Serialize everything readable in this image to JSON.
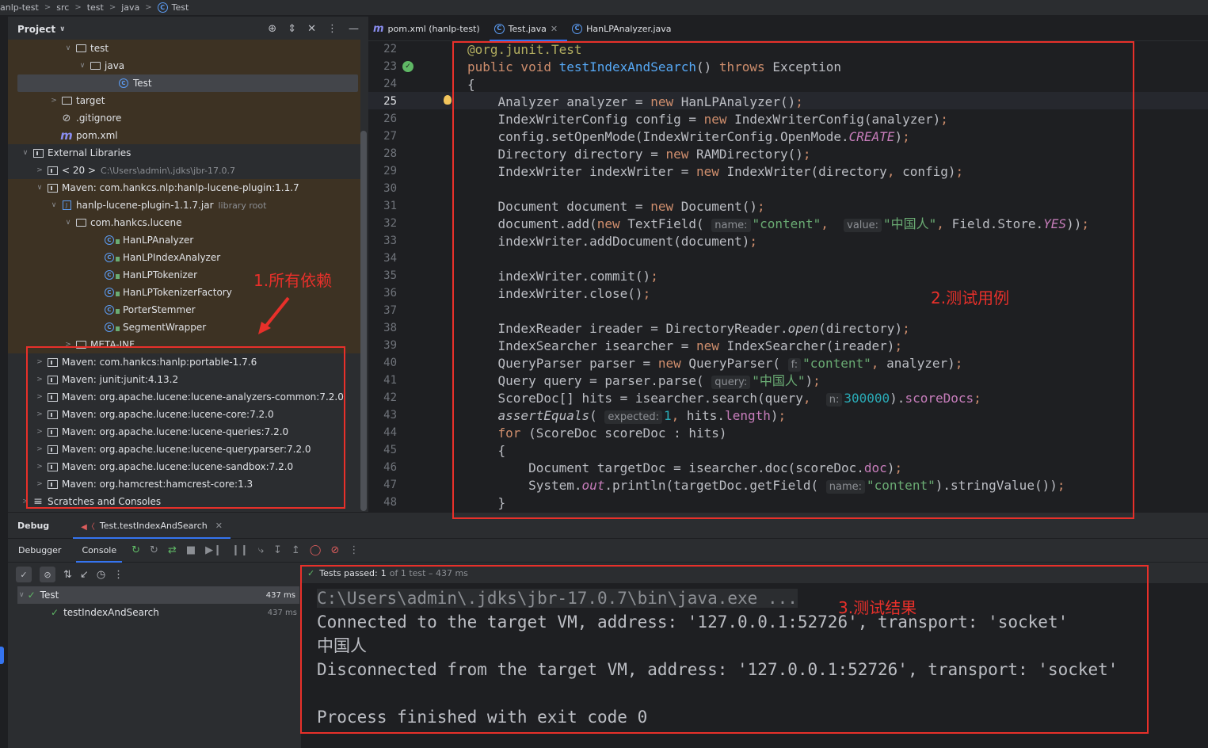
{
  "breadcrumb": [
    "anlp-test",
    "src",
    "test",
    "java",
    "Test"
  ],
  "project": {
    "title": "Project",
    "tree": [
      {
        "label": "test",
        "indent": 4,
        "chev": "v",
        "icon": "folder"
      },
      {
        "label": "java",
        "indent": 5,
        "chev": "v",
        "icon": "folder"
      },
      {
        "label": "Test",
        "indent": 7,
        "chev": "",
        "icon": "class",
        "selected": true
      },
      {
        "label": "target",
        "indent": 3,
        "chev": ">",
        "icon": "folder"
      },
      {
        "label": ".gitignore",
        "indent": 3,
        "chev": "",
        "icon": "ignore"
      },
      {
        "label": "pom.xml",
        "indent": 3,
        "chev": "",
        "icon": "maven"
      },
      {
        "label": "External Libraries",
        "indent": 1,
        "chev": "v",
        "icon": "lib"
      },
      {
        "label": "< 20 >",
        "extra": "C:\\Users\\admin\\.jdks\\jbr-17.0.7",
        "indent": 2,
        "chev": ">",
        "icon": "lib"
      },
      {
        "label": "Maven: com.hankcs.nlp:hanlp-lucene-plugin:1.1.7",
        "indent": 2,
        "chev": "v",
        "icon": "lib"
      },
      {
        "label": "hanlp-lucene-plugin-1.1.7.jar",
        "extra": "library root",
        "indent": 3,
        "chev": "v",
        "icon": "jar"
      },
      {
        "label": "com.hankcs.lucene",
        "indent": 4,
        "chev": "v",
        "icon": "folder"
      },
      {
        "label": "HanLPAnalyzer",
        "indent": 6,
        "chev": "",
        "icon": "class"
      },
      {
        "label": "HanLPIndexAnalyzer",
        "indent": 6,
        "chev": "",
        "icon": "class"
      },
      {
        "label": "HanLPTokenizer",
        "indent": 6,
        "chev": "",
        "icon": "class"
      },
      {
        "label": "HanLPTokenizerFactory",
        "indent": 6,
        "chev": "",
        "icon": "class"
      },
      {
        "label": "PorterStemmer",
        "indent": 6,
        "chev": "",
        "icon": "class"
      },
      {
        "label": "SegmentWrapper",
        "indent": 6,
        "chev": "",
        "icon": "class"
      },
      {
        "label": "META-INF",
        "indent": 4,
        "chev": ">",
        "icon": "folder"
      },
      {
        "label": "Maven: com.hankcs:hanlp:portable-1.7.6",
        "indent": 2,
        "chev": ">",
        "icon": "lib"
      },
      {
        "label": "Maven: junit:junit:4.13.2",
        "indent": 2,
        "chev": ">",
        "icon": "lib"
      },
      {
        "label": "Maven: org.apache.lucene:lucene-analyzers-common:7.2.0",
        "indent": 2,
        "chev": ">",
        "icon": "lib"
      },
      {
        "label": "Maven: org.apache.lucene:lucene-core:7.2.0",
        "indent": 2,
        "chev": ">",
        "icon": "lib"
      },
      {
        "label": "Maven: org.apache.lucene:lucene-queries:7.2.0",
        "indent": 2,
        "chev": ">",
        "icon": "lib"
      },
      {
        "label": "Maven: org.apache.lucene:lucene-queryparser:7.2.0",
        "indent": 2,
        "chev": ">",
        "icon": "lib"
      },
      {
        "label": "Maven: org.apache.lucene:lucene-sandbox:7.2.0",
        "indent": 2,
        "chev": ">",
        "icon": "lib"
      },
      {
        "label": "Maven: org.hamcrest:hamcrest-core:1.3",
        "indent": 2,
        "chev": ">",
        "icon": "lib"
      },
      {
        "label": "Scratches and Consoles",
        "indent": 1,
        "chev": ">",
        "icon": "scratch"
      }
    ]
  },
  "editor": {
    "tabs": [
      {
        "label": "pom.xml (hanlp-test)",
        "icon": "m"
      },
      {
        "label": "Test.java",
        "icon": "c",
        "active": true
      },
      {
        "label": "HanLPAnalyzer.java",
        "icon": "c"
      }
    ],
    "first_line": 22,
    "current_line": 25,
    "lines": [
      "<span class='an'>@org.junit.Test</span>",
      "<span class='kw'>public void </span><span class='fn'>testIndexAndSearch</span>() <span class='kw'>throws </span>Exception",
      "{",
      "    Analyzer analyzer = <span class='kw'>new </span>HanLPAnalyzer()<span class='kw'>;</span>",
      "    IndexWriterConfig config = <span class='kw'>new </span>IndexWriterConfig(analyzer)<span class='kw'>;</span>",
      "    config.setOpenMode(IndexWriterConfig.OpenMode.<span class='pu'>CREATE</span>)<span class='kw'>;</span>",
      "    Directory directory = <span class='kw'>new </span>RAMDirectory()<span class='kw'>;</span>",
      "    IndexWriter indexWriter = <span class='kw'>new </span>IndexWriter(directory<span class='kw'>, </span>config)<span class='kw'>;</span>",
      "",
      "    Document document = <span class='kw'>new </span>Document()<span class='kw'>;</span>",
      "    document.add(<span class='kw'>new </span>TextField( <span class='hint'>name:</span><span class='st'>\"content\"</span><span class='kw'>, </span> <span class='hint'>value:</span><span class='st'>\"中国人\"</span><span class='kw'>, </span>Field.Store.<span class='pu'>YES</span>))<span class='kw'>;</span>",
      "    indexWriter.addDocument(document)<span class='kw'>;</span>",
      "",
      "    indexWriter.commit()<span class='kw'>;</span>",
      "    indexWriter.close()<span class='kw'>;</span>",
      "",
      "    IndexReader ireader = DirectoryReader.<span class='it'>open</span>(directory)<span class='kw'>;</span>",
      "    IndexSearcher isearcher = <span class='kw'>new </span>IndexSearcher(ireader)<span class='kw'>;</span>",
      "    QueryParser parser = <span class='kw'>new </span>QueryParser( <span class='hint'>f:</span><span class='st'>\"content\"</span><span class='kw'>, </span>analyzer)<span class='kw'>;</span>",
      "    Query query = parser.parse( <span class='hint'>query:</span><span class='st'>\"中国人\"</span>)<span class='kw'>;</span>",
      "    ScoreDoc[] hits = isearcher.search(query<span class='kw'>, </span> <span class='hint'>n:</span><span class='num'>300000</span>).<span class='pu' style='font-style:normal'>scoreDocs</span><span class='kw'>;</span>",
      "    <span class='it'>assertEquals</span>( <span class='hint'>expected:</span><span class='num'>1</span><span class='kw'>, </span>hits.<span class='pu' style='font-style:normal'>length</span>)<span class='kw'>;</span>",
      "    <span class='kw'>for </span>(ScoreDoc scoreDoc : hits)",
      "    {",
      "        Document targetDoc = isearcher.doc(scoreDoc.<span class='pu' style='font-style:normal'>doc</span>)<span class='kw'>;</span>",
      "        System.<span class='pu'>out</span>.println(targetDoc.getField( <span class='hint'>name:</span><span class='st'>\"content\"</span>).stringValue())<span class='kw'>;</span>",
      "    }"
    ]
  },
  "debug": {
    "title": "Debug",
    "session": "Test.testIndexAndSearch",
    "tabs": [
      "Debugger",
      "Console"
    ],
    "active_tab": "Console",
    "tests": [
      {
        "label": "Test",
        "time": "437 ms",
        "indent": 0
      },
      {
        "label": "testIndexAndSearch",
        "time": "437 ms",
        "indent": 1
      }
    ],
    "status_passed": "Tests passed:",
    "status_count": "1",
    "status_rest": "of 1 test – 437 ms",
    "console_lines": [
      "C:\\Users\\admin\\.jdks\\jbr-17.0.7\\bin\\java.exe ...",
      "Connected to the target VM, address: '127.0.0.1:52726', transport: 'socket'",
      "中国人",
      "Disconnected from the target VM, address: '127.0.0.1:52726', transport: 'socket'",
      "",
      "Process finished with exit code 0"
    ]
  },
  "annotations": {
    "all_deps": "1.所有依赖",
    "test_case": "2.测试用例",
    "test_result": "3.测试结果",
    "color": "#e8302a"
  }
}
